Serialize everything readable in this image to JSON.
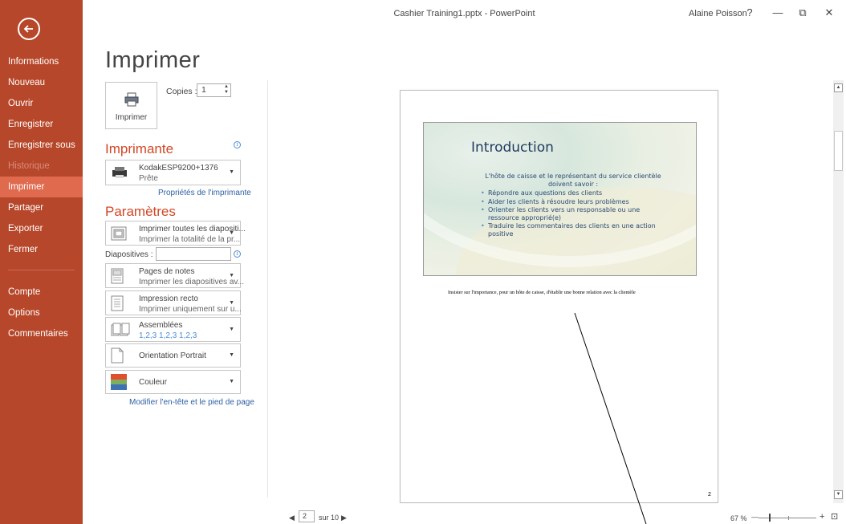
{
  "window": {
    "title": "Cashier Training1.pptx - PowerPoint",
    "user": "Alaine Poisson",
    "help": "?",
    "minimize": "—",
    "restore": "⧉",
    "close": "✕"
  },
  "sidebar": {
    "items": [
      {
        "label": "Informations",
        "state": "normal"
      },
      {
        "label": "Nouveau",
        "state": "normal"
      },
      {
        "label": "Ouvrir",
        "state": "normal"
      },
      {
        "label": "Enregistrer",
        "state": "normal"
      },
      {
        "label": "Enregistrer sous",
        "state": "normal"
      },
      {
        "label": "Historique",
        "state": "disabled"
      },
      {
        "label": "Imprimer",
        "state": "active"
      },
      {
        "label": "Partager",
        "state": "normal"
      },
      {
        "label": "Exporter",
        "state": "normal"
      },
      {
        "label": "Fermer",
        "state": "normal"
      }
    ],
    "bottom_items": [
      {
        "label": "Compte"
      },
      {
        "label": "Options"
      },
      {
        "label": "Commentaires"
      }
    ],
    "colors": {
      "background": "#b7472a",
      "active": "#e06a4e"
    }
  },
  "print": {
    "title": "Imprimer",
    "print_button": "Imprimer",
    "copies_label": "Copies :",
    "copies_value": "1",
    "printer_section": "Imprimante",
    "printer_name": "KodakESP9200+1376",
    "printer_status": "Prête",
    "printer_properties": "Propriétés de l'imprimante",
    "settings_section": "Paramètres",
    "settings": [
      {
        "line1": "Imprimer toutes les diapositi...",
        "line2": "Imprimer la totalité de la pr...",
        "icon": "slides-icon"
      },
      {
        "line1": "Pages de notes",
        "line2": "Imprimer les diapositives av...",
        "icon": "notes-page-icon"
      },
      {
        "line1": "Impression recto",
        "line2": "Imprimer uniquement sur u...",
        "icon": "one-sided-icon"
      },
      {
        "line1": "Assemblées",
        "line2": "1,2,3   1,2,3   1,2,3",
        "icon": "collated-icon"
      },
      {
        "line1": "Orientation Portrait",
        "line2": "",
        "icon": "portrait-icon"
      },
      {
        "line1": "Couleur",
        "line2": "",
        "icon": "color-icon"
      }
    ],
    "slides_label": "Diapositives :",
    "slides_value": "",
    "header_footer_link": "Modifier l'en-tête et le pied de page",
    "accent_color": "#d24726"
  },
  "preview": {
    "slide_title": "Introduction",
    "slide_intro": "L'hôte de caisse et le représentant du service clientèle doivent savoir :",
    "slide_bullets": [
      "Répondre aux questions des clients",
      "Aider les clients à résoudre leurs problèmes",
      "Orienter les clients vers un responsable ou une ressource approprié(e)",
      "Traduire les commentaires des clients en une action positive"
    ],
    "notes_text": "Insister sur l'importance, pour un hôte de caisse, d'établir une bonne relation avec la clientèle",
    "page_number": "2"
  },
  "footer": {
    "prev": "◀",
    "current_page": "2",
    "total": "sur 10",
    "next": "▶",
    "zoom": "67 %",
    "zoom_minus": "—",
    "zoom_plus": "+",
    "fit_page": "⊡"
  }
}
